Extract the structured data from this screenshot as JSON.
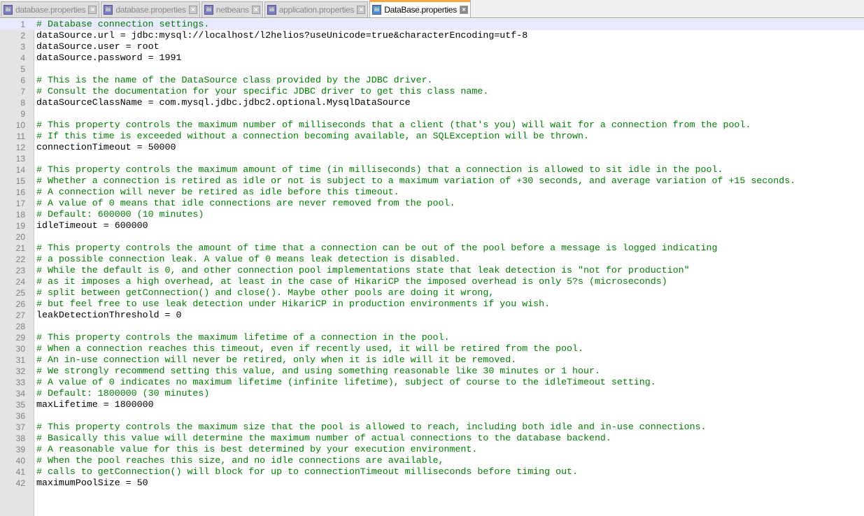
{
  "tabs": [
    {
      "label": "database.properties",
      "active": false
    },
    {
      "label": "database.properties",
      "active": false
    },
    {
      "label": "netbeans",
      "active": false
    },
    {
      "label": "application.properties",
      "active": false
    },
    {
      "label": "DataBase.properties",
      "active": true
    }
  ],
  "colors": {
    "comment": "#008000",
    "text": "#000000",
    "accent": "#f7a94a"
  },
  "lines": [
    "# Database connection settings.",
    "dataSource.url = jdbc:mysql://localhost/l2helios?useUnicode=true&characterEncoding=utf-8",
    "dataSource.user = root",
    "dataSource.password = 1991",
    "",
    "# This is the name of the DataSource class provided by the JDBC driver.",
    "# Consult the documentation for your specific JDBC driver to get this class name.",
    "dataSourceClassName = com.mysql.jdbc.jdbc2.optional.MysqlDataSource",
    "",
    "# This property controls the maximum number of milliseconds that a client (that's you) will wait for a connection from the pool.",
    "# If this time is exceeded without a connection becoming available, an SQLException will be thrown.",
    "connectionTimeout = 50000",
    "",
    "# This property controls the maximum amount of time (in milliseconds) that a connection is allowed to sit idle in the pool.",
    "# Whether a connection is retired as idle or not is subject to a maximum variation of +30 seconds, and average variation of +15 seconds.",
    "# A connection will never be retired as idle before this timeout.",
    "# A value of 0 means that idle connections are never removed from the pool.",
    "# Default: 600000 (10 minutes)",
    "idleTimeout = 600000",
    "",
    "# This property controls the amount of time that a connection can be out of the pool before a message is logged indicating",
    "# a possible connection leak. A value of 0 means leak detection is disabled.",
    "# While the default is 0, and other connection pool implementations state that leak detection is \"not for production\"",
    "# as it imposes a high overhead, at least in the case of HikariCP the imposed overhead is only 5?s (microseconds)",
    "# split between getConnection() and close(). Maybe other pools are doing it wrong,",
    "# but feel free to use leak detection under HikariCP in production environments if you wish.",
    "leakDetectionThreshold = 0",
    "",
    "# This property controls the maximum lifetime of a connection in the pool.",
    "# When a connection reaches this timeout, even if recently used, it will be retired from the pool.",
    "# An in-use connection will never be retired, only when it is idle will it be removed.",
    "# We strongly recommend setting this value, and using something reasonable like 30 minutes or 1 hour.",
    "# A value of 0 indicates no maximum lifetime (infinite lifetime), subject of course to the idleTimeout setting.",
    "# Default: 1800000 (30 minutes)",
    "maxLifetime = 1800000",
    "",
    "# This property controls the maximum size that the pool is allowed to reach, including both idle and in-use connections.",
    "# Basically this value will determine the maximum number of actual connections to the database backend.",
    "# A reasonable value for this is best determined by your execution environment.",
    "# When the pool reaches this size, and no idle connections are available,",
    "# calls to getConnection() will block for up to connectionTimeout milliseconds before timing out.",
    "maximumPoolSize = 50"
  ]
}
